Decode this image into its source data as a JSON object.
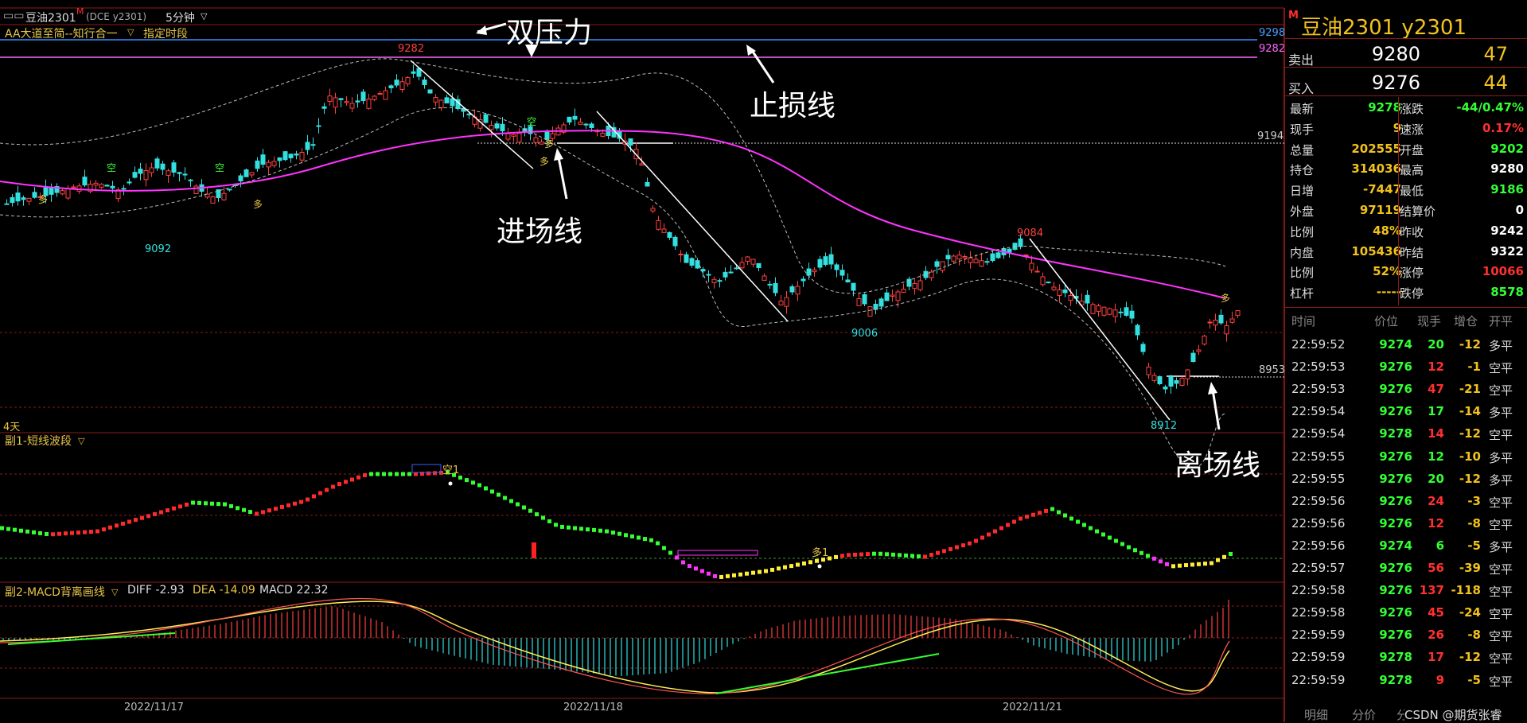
{
  "header": {
    "symbol": "豆油2301",
    "marker": "M",
    "exchange": "(DCE y2301)",
    "period": "5分钟"
  },
  "indicator_bar": {
    "name": "AA大道至简--知行合一",
    "dropdown": "指定时段"
  },
  "main_chart": {
    "annotations": {
      "double_pressure": "双压力",
      "stop_loss": "止损线",
      "entry": "进场线",
      "exit": "离场线"
    },
    "price_labels": {
      "high1": "9282",
      "low1": "9092",
      "low2": "9006",
      "high2": "9084",
      "low3": "8912",
      "entry_level": "9194",
      "exit_level": "8953",
      "right_9298": "9298",
      "right_9282": "9282"
    },
    "days_label": "4天",
    "signal_labels": {
      "long": "多",
      "short": "空"
    }
  },
  "sub1": {
    "title": "副1-短线波段",
    "marker_short": "空1",
    "marker_long": "多1"
  },
  "sub2": {
    "title": "副2-MACD背离画线",
    "diff_label": "DIFF",
    "diff_value": "-2.93",
    "dea_label": "DEA",
    "dea_value": "-14.09",
    "macd_label": "MACD",
    "macd_value": "22.32"
  },
  "x_axis": {
    "dates": [
      "2022/11/17",
      "2022/11/18",
      "2022/11/21"
    ]
  },
  "quote_panel": {
    "title": "豆油2301  y2301",
    "marker": "M",
    "sell": {
      "label": "卖出",
      "price": "9280",
      "volume": "47"
    },
    "buy": {
      "label": "买入",
      "price": "9276",
      "volume": "44"
    },
    "stats_left": [
      {
        "label": "最新",
        "value": "9278",
        "color": "#33ff33"
      },
      {
        "label": "现手",
        "value": "9",
        "color": "#f2c21b"
      },
      {
        "label": "总量",
        "value": "202555",
        "color": "#f2c21b"
      },
      {
        "label": "持仓",
        "value": "314036",
        "color": "#f2c21b"
      },
      {
        "label": "日增",
        "value": "-7447",
        "color": "#f2c21b"
      },
      {
        "label": "外盘",
        "value": "97119",
        "color": "#f2c21b"
      },
      {
        "label": "比例",
        "value": "48%",
        "color": "#f2c21b"
      },
      {
        "label": "内盘",
        "value": "105436",
        "color": "#f2c21b"
      },
      {
        "label": "比例",
        "value": "52%",
        "color": "#f2c21b"
      },
      {
        "label": "杠杆",
        "value": "-----",
        "color": "#f2c21b"
      }
    ],
    "stats_right": [
      {
        "label": "涨跌",
        "value": "-44/0.47%",
        "color": "#33ff33"
      },
      {
        "label": "速涨",
        "value": "0.17%",
        "color": "#ff3030"
      },
      {
        "label": "开盘",
        "value": "9202",
        "color": "#33ff33"
      },
      {
        "label": "最高",
        "value": "9280",
        "color": "#ffffff"
      },
      {
        "label": "最低",
        "value": "9186",
        "color": "#33ff33"
      },
      {
        "label": "结算价",
        "value": "0",
        "color": "#ffffff"
      },
      {
        "label": "昨收",
        "value": "9242",
        "color": "#ffffff"
      },
      {
        "label": "昨结",
        "value": "9322",
        "color": "#ffffff"
      },
      {
        "label": "涨停",
        "value": "10066",
        "color": "#ff3030"
      },
      {
        "label": "跌停",
        "value": "8578",
        "color": "#33ff33"
      }
    ],
    "tick_headers": [
      "时间",
      "价位",
      "现手",
      "增仓",
      "开平"
    ],
    "ticks": [
      {
        "time": "22:59:52",
        "price": "9274",
        "vol": "20",
        "oi": "-12",
        "type": "多平"
      },
      {
        "time": "22:59:53",
        "price": "9276",
        "vol": "12",
        "oi": "-1",
        "type": "空平"
      },
      {
        "time": "22:59:53",
        "price": "9276",
        "vol": "47",
        "oi": "-21",
        "type": "空平"
      },
      {
        "time": "22:59:54",
        "price": "9276",
        "vol": "17",
        "oi": "-14",
        "type": "多平"
      },
      {
        "time": "22:59:54",
        "price": "9278",
        "vol": "14",
        "oi": "-12",
        "type": "空平"
      },
      {
        "time": "22:59:55",
        "price": "9276",
        "vol": "12",
        "oi": "-10",
        "type": "多平"
      },
      {
        "time": "22:59:55",
        "price": "9276",
        "vol": "20",
        "oi": "-12",
        "type": "多平"
      },
      {
        "time": "22:59:56",
        "price": "9276",
        "vol": "24",
        "oi": "-3",
        "type": "空平"
      },
      {
        "time": "22:59:56",
        "price": "9276",
        "vol": "12",
        "oi": "-8",
        "type": "空平"
      },
      {
        "time": "22:59:56",
        "price": "9274",
        "vol": "6",
        "oi": "-5",
        "type": "多平"
      },
      {
        "time": "22:59:57",
        "price": "9276",
        "vol": "56",
        "oi": "-39",
        "type": "空平"
      },
      {
        "time": "22:59:58",
        "price": "9276",
        "vol": "137",
        "oi": "-118",
        "type": "空平"
      },
      {
        "time": "22:59:58",
        "price": "9276",
        "vol": "45",
        "oi": "-24",
        "type": "空平"
      },
      {
        "time": "22:59:59",
        "price": "9276",
        "vol": "26",
        "oi": "-8",
        "type": "空平"
      },
      {
        "time": "22:59:59",
        "price": "9278",
        "vol": "17",
        "oi": "-12",
        "type": "空平"
      },
      {
        "time": "22:59:59",
        "price": "9278",
        "vol": "9",
        "oi": "-5",
        "type": "空平"
      }
    ],
    "tabs": [
      "明细",
      "分价",
      "分笔"
    ],
    "watermark": "CSDN @期货张睿"
  }
}
